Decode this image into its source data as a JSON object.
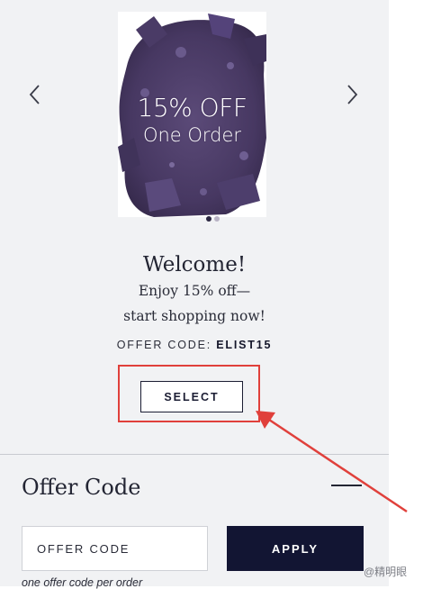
{
  "promo": {
    "line1": "15% OFF",
    "line2": "One Order",
    "slide_count": 2,
    "active_slide": 1
  },
  "nav": {
    "prev_icon": "chevron-left-icon",
    "next_icon": "chevron-right-icon"
  },
  "welcome": {
    "title": "Welcome!",
    "line1": "Enjoy 15% off—",
    "line2": "start shopping now!",
    "offer_code_label": "OFFER CODE:",
    "offer_code_value": "ELIST15",
    "select_label": "SELECT"
  },
  "offer_section": {
    "title": "Offer Code",
    "input_placeholder": "OFFER CODE",
    "input_value": "",
    "apply_label": "APPLY",
    "note": "one offer code per order"
  },
  "watermark": "@精明眼",
  "colors": {
    "accent_dark": "#121533",
    "annotation_red": "#e0403b",
    "panel_bg": "#f1f2f4"
  }
}
